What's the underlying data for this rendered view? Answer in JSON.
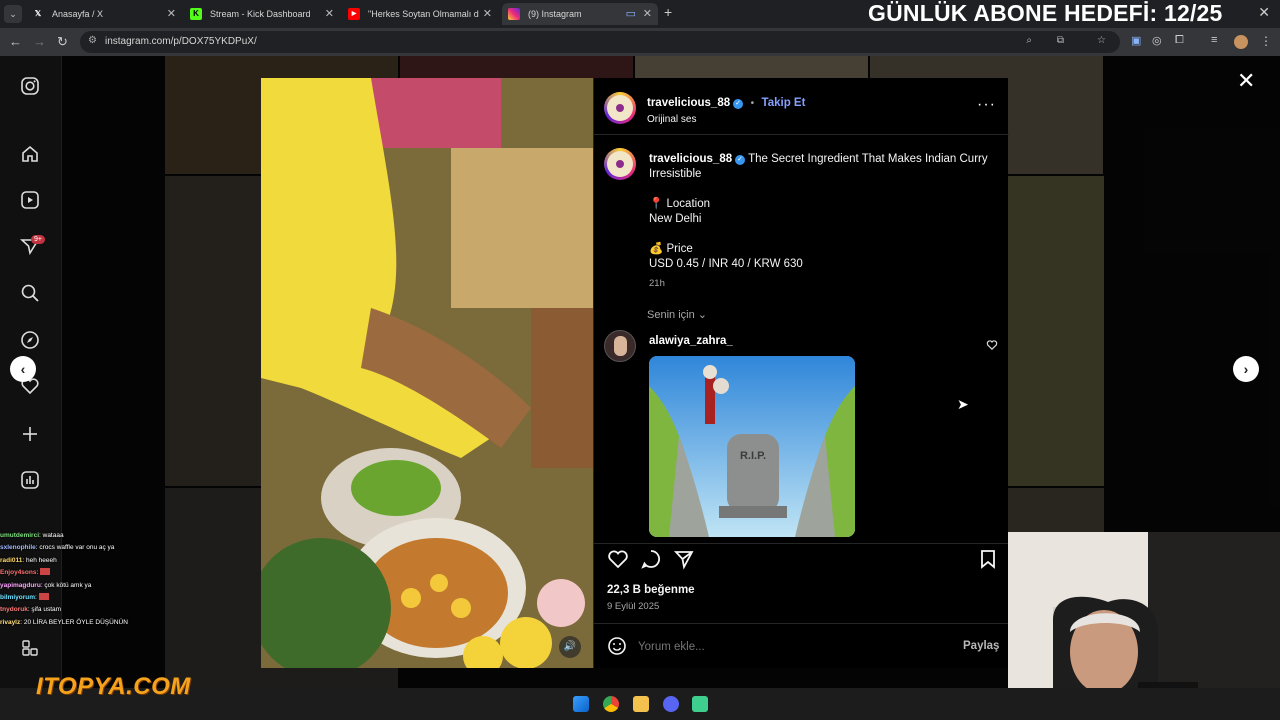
{
  "browser": {
    "tabs": [
      {
        "label": "Anasayfa / X",
        "favicon": "x-logo"
      },
      {
        "label": "Stream - Kick Dashboard",
        "favicon": "kick-logo"
      },
      {
        "label": "\"Herkes Soytan Olmamalı d",
        "favicon": "youtube-logo"
      },
      {
        "label": "(9) Instagram",
        "favicon": "instagram-logo"
      }
    ],
    "url": "instagram.com/p/DOX75YKDPuX/"
  },
  "overlay_goal": "GÜNLÜK ABONE HEDEFİ: 12/25",
  "sidebar": {
    "notification_badge": "9+"
  },
  "post": {
    "username": "travelicious_88",
    "follow_label": "Takip Et",
    "audio_label": "Orijinal ses",
    "caption_title": "The Secret Ingredient That Makes Indian Curry Irresistible",
    "location_label": "📍 Location",
    "location_value": "New Delhi",
    "price_label": "💰 Price",
    "price_value": "USD 0.45 / INR 40 / KRW 630",
    "time_ago": "21h",
    "filter_label": "Senin için",
    "comment_user": "alawiya_zahra_",
    "likes": "22,3 B beğenme",
    "date": "9 Eylül 2025",
    "comment_placeholder": "Yorum ekle...",
    "share_label": "Paylaş",
    "comment_image_text": "R.I.P."
  },
  "chat": [
    {
      "user": "umutdemirci",
      "msg": ": wataaa"
    },
    {
      "user": "sxlenophile",
      "msg": ": crocs waffle var onu aç ya"
    },
    {
      "user": "radi011",
      "msg": ": heh heeeh"
    },
    {
      "user": "Enjoy4sons",
      "msg": ": "
    },
    {
      "user": "yapimagduru",
      "msg": ": çok kötü amk ya"
    },
    {
      "user": "bilmiyorum",
      "msg": ": "
    },
    {
      "user": "tnydoruk",
      "msg": ": şifa ustam"
    },
    {
      "user": "rivaylz",
      "msg": ": 20 LİRA BEYLER ÖYLE DÜŞÜNÜN"
    }
  ],
  "sponsor": "ITOPYA.COM",
  "colors": {
    "accent_blue": "#3797f0",
    "follow_blue": "#85a1ff",
    "panel_bg": "#000000"
  }
}
